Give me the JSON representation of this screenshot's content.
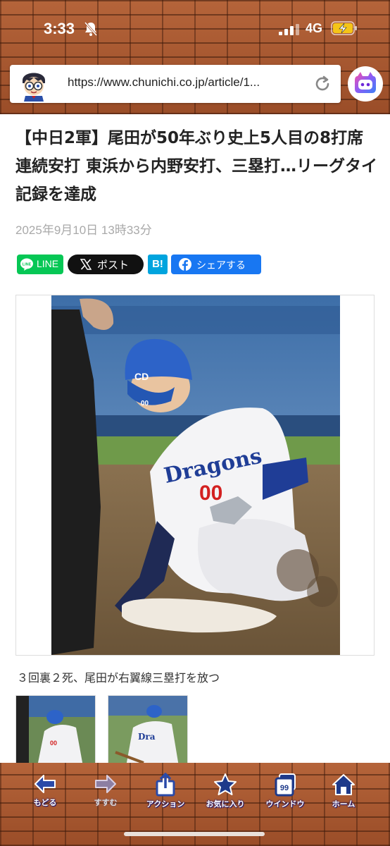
{
  "status_bar": {
    "time": "3:33",
    "network": "4G"
  },
  "browser": {
    "url": "https://www.chunichi.co.jp/article/1..."
  },
  "article": {
    "headline": "【中日2軍】尾田が50年ぶり史上5人目の8打席連続安打 東浜から内野安打、三塁打…リーグタイ記録を達成",
    "date": "2025年9月10日 13時33分",
    "share": {
      "line_label": "LINE",
      "x_label": "ポスト",
      "hatena_label": "B!",
      "facebook_label": "シェアする"
    },
    "caption": "３回裏２死、尾田が右翼線三塁打を放つ"
  },
  "toolbar": {
    "back": "もどる",
    "forward": "すすむ",
    "action": "アクション",
    "favorites": "お気に入り",
    "windows": "ウインドウ",
    "window_count": "99",
    "home": "ホーム"
  },
  "colors": {
    "brick": "#a0522d",
    "line_green": "#06c755",
    "hatena_blue": "#00a4de",
    "facebook_blue": "#1877f2",
    "toolbar_icon": "#1e3a8a"
  },
  "icons": [
    "bell-slash-icon",
    "signal-icon",
    "battery-charging-icon",
    "reload-icon",
    "assistant-icon",
    "line-icon",
    "x-logo-icon",
    "facebook-icon",
    "back-arrow-icon",
    "forward-arrow-icon",
    "share-icon",
    "star-icon",
    "windows-icon",
    "home-icon"
  ]
}
